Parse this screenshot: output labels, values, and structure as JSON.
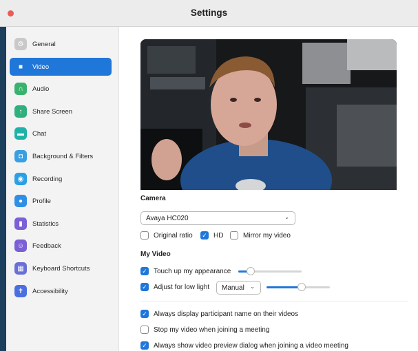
{
  "window": {
    "title": "Settings"
  },
  "colors": {
    "accent": "#1f77d9",
    "close": "#ee5b56"
  },
  "sidebar": {
    "items": [
      {
        "label": "General",
        "icon": "gear-icon",
        "color": "#c9c9c9",
        "glyph": "⚙",
        "active": false
      },
      {
        "label": "Video",
        "icon": "video-camera-icon",
        "color": "#1f77d9",
        "glyph": "■",
        "active": true
      },
      {
        "label": "Audio",
        "icon": "headphones-icon",
        "color": "#3ab26e",
        "glyph": "∩",
        "active": false
      },
      {
        "label": "Share Screen",
        "icon": "share-screen-icon",
        "color": "#2fb07c",
        "glyph": "↑",
        "active": false
      },
      {
        "label": "Chat",
        "icon": "chat-bubble-icon",
        "color": "#1fb3a8",
        "glyph": "▬",
        "active": false
      },
      {
        "label": "Background & Filters",
        "icon": "background-person-icon",
        "color": "#3a9fe0",
        "glyph": "◘",
        "active": false
      },
      {
        "label": "Recording",
        "icon": "record-icon",
        "color": "#2aa0e6",
        "glyph": "◉",
        "active": false
      },
      {
        "label": "Profile",
        "icon": "profile-person-icon",
        "color": "#2f8fe6",
        "glyph": "●",
        "active": false
      },
      {
        "label": "Statistics",
        "icon": "bar-chart-icon",
        "color": "#7a5fd6",
        "glyph": "▮",
        "active": false
      },
      {
        "label": "Feedback",
        "icon": "smiley-face-icon",
        "color": "#7a5fd6",
        "glyph": "☺",
        "active": false
      },
      {
        "label": "Keyboard Shortcuts",
        "icon": "keyboard-icon",
        "color": "#6a6fd6",
        "glyph": "▦",
        "active": false
      },
      {
        "label": "Accessibility",
        "icon": "accessibility-person-icon",
        "color": "#4a6fe0",
        "glyph": "✝",
        "active": false
      }
    ]
  },
  "video": {
    "camera_label": "Camera",
    "camera_selected": "Avaya HC020",
    "options": [
      {
        "label": "Original ratio",
        "checked": false
      },
      {
        "label": "HD",
        "checked": true
      },
      {
        "label": "Mirror my video",
        "checked": false
      }
    ],
    "my_video_label": "My Video",
    "touch_up": {
      "label": "Touch up my appearance",
      "checked": true,
      "level": 0.2
    },
    "low_light": {
      "label": "Adjust for low light",
      "checked": true,
      "mode": "Manual",
      "level": 0.55
    },
    "prefs": [
      {
        "label": "Always display participant name on their videos",
        "checked": true
      },
      {
        "label": "Stop my video when joining a meeting",
        "checked": false
      },
      {
        "label": "Always show video preview dialog when joining a video meeting",
        "checked": true
      }
    ]
  }
}
